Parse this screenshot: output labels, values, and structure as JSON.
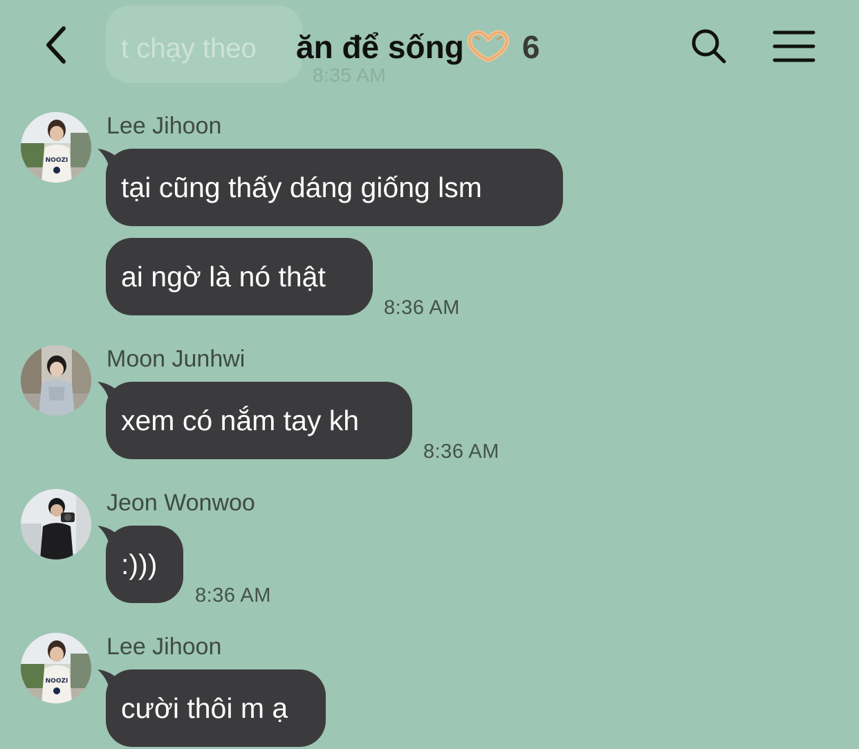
{
  "header": {
    "title": "ăn để sống",
    "member_count": "6",
    "back_icon": "chevron-left-icon",
    "search_icon": "search-icon",
    "menu_icon": "menu-icon"
  },
  "previous_message": {
    "text": "t chạy theo",
    "time": "8:35 AM"
  },
  "messages": [
    {
      "sender": "Lee Jihoon",
      "bubbles": [
        "tại cũng thấy dáng giống lsm",
        "ai ngờ là nó thật"
      ],
      "time": "8:36 AM"
    },
    {
      "sender": "Moon Junhwi",
      "bubbles": [
        "xem có nắm tay kh"
      ],
      "time": "8:36 AM"
    },
    {
      "sender": "Jeon Wonwoo",
      "bubbles": [
        ":)))"
      ],
      "time": "8:36 AM"
    },
    {
      "sender": "Lee Jihoon",
      "bubbles": [
        "cười thôi m ạ"
      ],
      "time": ""
    }
  ],
  "colors": {
    "background": "#9dc6b4",
    "bubble": "#3b3b3d",
    "bubble_text": "#ffffff",
    "name_text": "#3f4a45",
    "time_text": "#45524c"
  }
}
